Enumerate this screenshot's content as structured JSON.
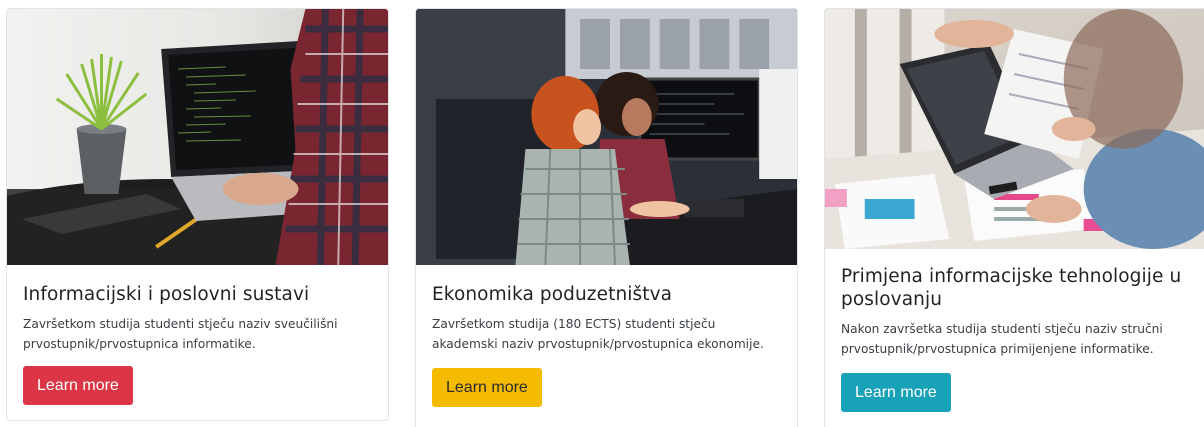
{
  "cards": [
    {
      "title": "Informacijski i poslovni sustavi",
      "text": "Završetkom studija studenti stječu naziv sveučilišni prvostupnik/prvostupnica informatike.",
      "button_label": "Learn more",
      "button_color": "#dc3545",
      "image_alt": "Person typing code on a laptop next to a potted plant"
    },
    {
      "title": "Ekonomika poduzetništva",
      "text": "Završetkom studija (180 ECTS) studenti stječu akademski naziv prvostupnik/prvostupnica ekonomije.",
      "button_label": "Learn more",
      "button_color": "#f5bb00",
      "image_alt": "Two women looking at computer monitors"
    },
    {
      "title": "Primjena informacijske tehnologije u poslovanju",
      "text": "Nakon završetka studija studenti stječu naziv stručni prvostupnik/prvostupnica primijenjene informatike.",
      "button_label": "Learn more",
      "button_color": "#17a2b8",
      "image_alt": "Business people reviewing documents and a laptop"
    }
  ]
}
